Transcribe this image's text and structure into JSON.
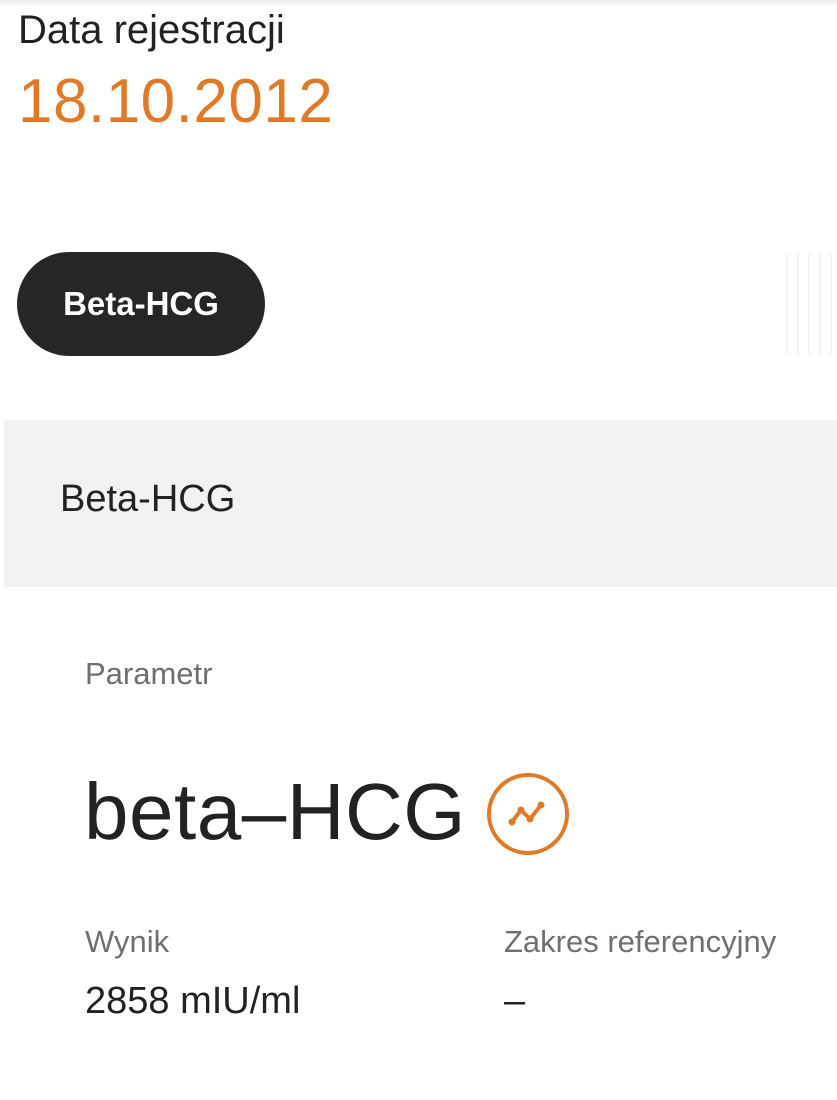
{
  "registration": {
    "label": "Data rejestracji",
    "date": "18.10.2012"
  },
  "filter_chips": [
    {
      "label": "Beta-HCG",
      "selected": true
    }
  ],
  "section": {
    "title": "Beta-HCG"
  },
  "parameter": {
    "label": "Parametr",
    "name": "beta–HCG",
    "chart_icon": "trend-chart-icon"
  },
  "result": {
    "label": "Wynik",
    "value": "2858 mIU/ml"
  },
  "reference_range": {
    "label": "Zakres referencyjny",
    "value": "–"
  },
  "colors": {
    "accent": "#e07a28",
    "chip_background": "#262626",
    "section_background": "#f2f2f2",
    "muted_text": "#6f6f6f"
  }
}
